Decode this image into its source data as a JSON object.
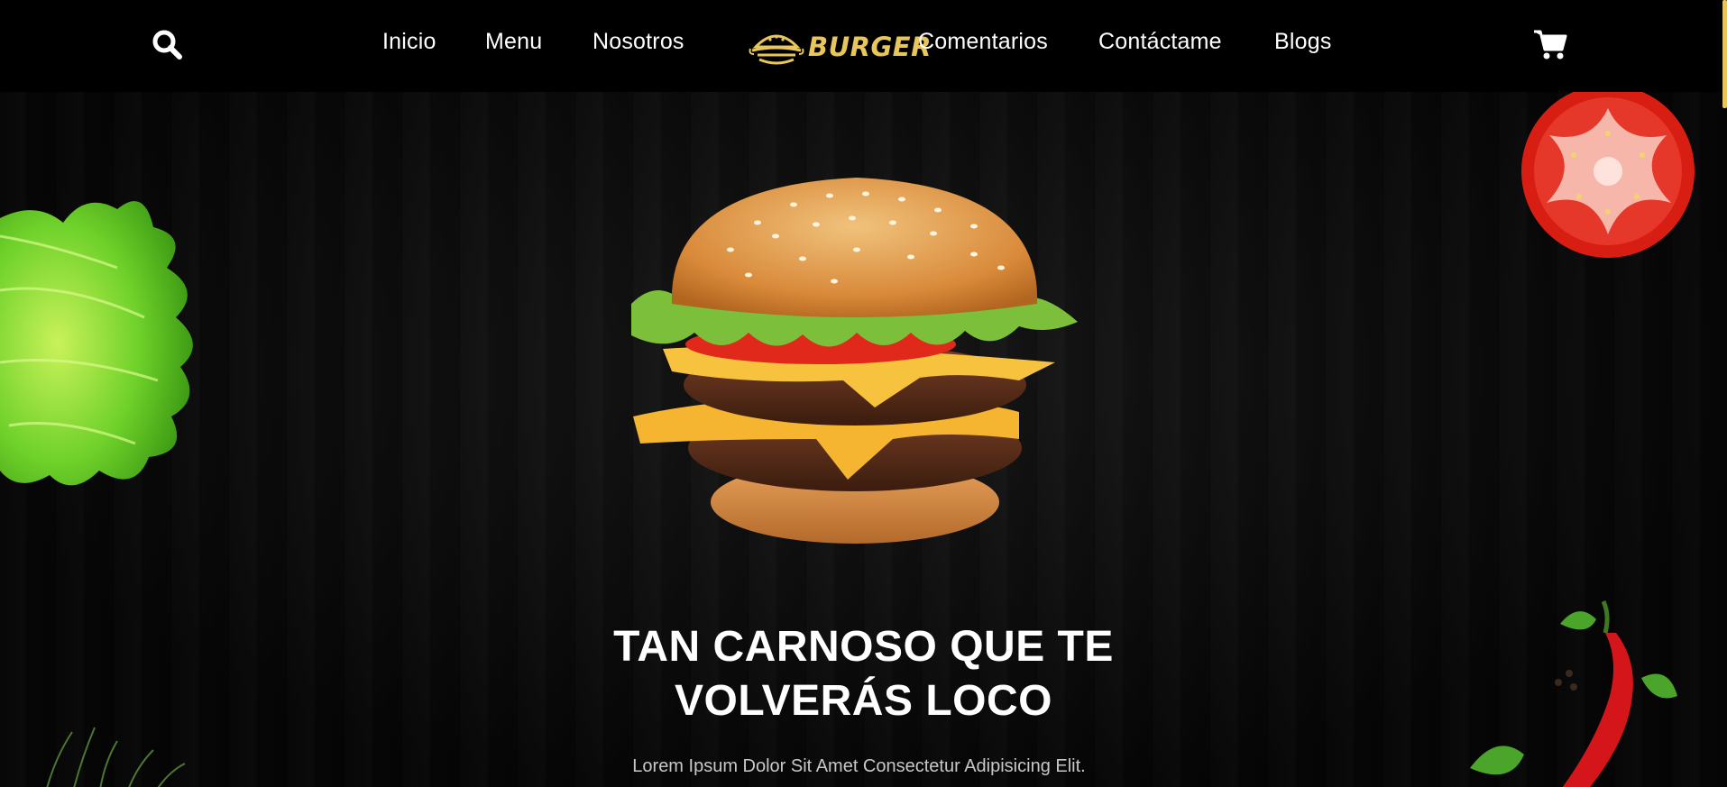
{
  "nav": {
    "links": [
      "Inicio",
      "Menu",
      "Nosotros",
      "Comentarios",
      "Contáctame",
      "Blogs"
    ],
    "logo_text": "BURGER",
    "search_icon": "search-icon",
    "cart_icon": "shopping-cart-icon"
  },
  "hero": {
    "headline_line1": "TAN CARNOSO QUE TE",
    "headline_line2": "VOLVERÁS LOCO",
    "subtext": "Lorem Ipsum Dolor Sit Amet Consectetur Adipisicing Elit."
  },
  "colors": {
    "background": "#000000",
    "accent": "#e8c65a",
    "text": "#ffffff"
  }
}
